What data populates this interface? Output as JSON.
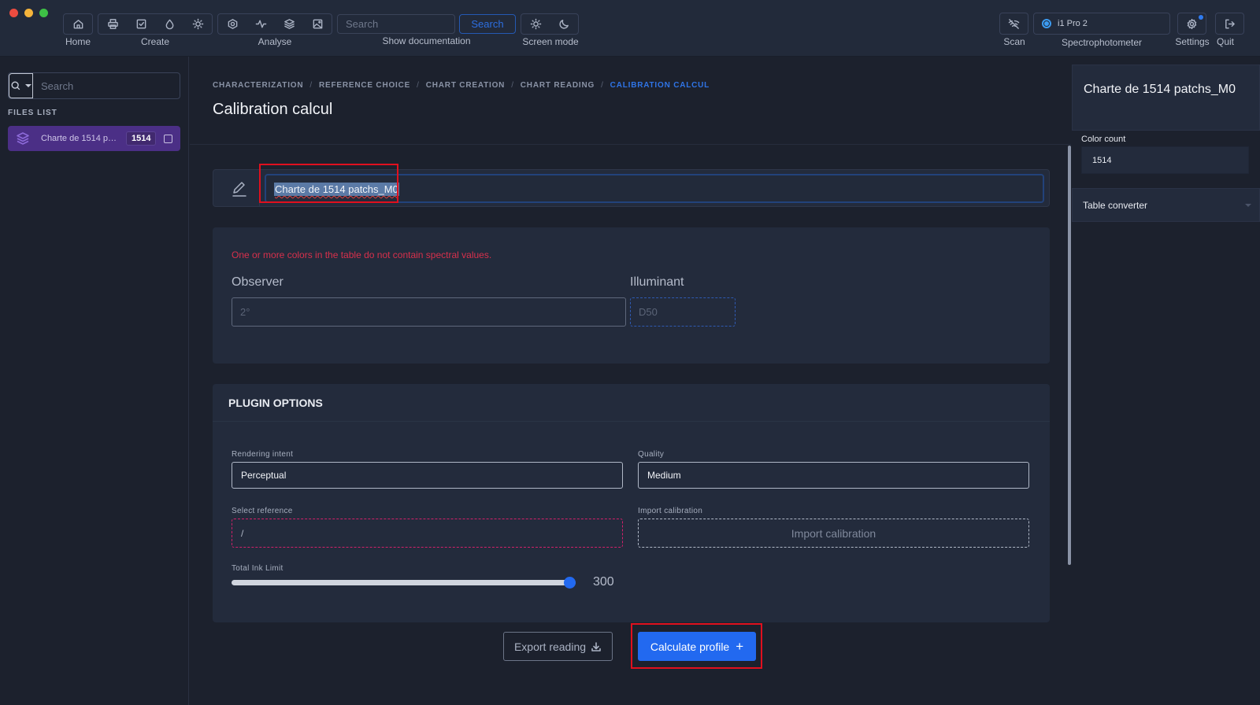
{
  "toolbar": {
    "groups": {
      "home": {
        "label": "Home"
      },
      "create": {
        "label": "Create"
      },
      "analyse": {
        "label": "Analyse"
      },
      "documentation": {
        "label": "Show documentation",
        "search_placeholder": "Search",
        "search_button": "Search"
      },
      "screen_mode": {
        "label": "Screen mode"
      }
    },
    "scan": {
      "label": "Scan"
    },
    "spectrophotometer": {
      "label": "Spectrophotometer",
      "device": "i1 Pro 2"
    },
    "settings": {
      "label": "Settings"
    },
    "quit": {
      "label": "Quit"
    }
  },
  "sidebar": {
    "search_placeholder": "Search",
    "files_list_label": "FILES LIST",
    "files": [
      {
        "name": "Charte de 1514 patchs_M0",
        "count": "1514",
        "checked": false
      }
    ]
  },
  "main": {
    "breadcrumb": [
      {
        "label": "CHARACTERIZATION",
        "active": false
      },
      {
        "label": "REFERENCE CHOICE",
        "active": false
      },
      {
        "label": "CHART CREATION",
        "active": false
      },
      {
        "label": "CHART READING",
        "active": false
      },
      {
        "label": "CALIBRATION CALCUL",
        "active": true
      }
    ],
    "breadcrumb_separator": "/",
    "title": "Calibration calcul",
    "chart_name": "Charte de 1514 patchs_M0",
    "spectral": {
      "error": "One or more colors in the table do not contain spectral values.",
      "observer_label": "Observer",
      "observer_value": "2°",
      "illuminant_label": "Illuminant",
      "illuminant_value": "D50"
    },
    "plugin_options": {
      "title": "PLUGIN OPTIONS",
      "rendering_intent_label": "Rendering intent",
      "rendering_intent_value": "Perceptual",
      "quality_label": "Quality",
      "quality_value": "Medium",
      "select_reference_label": "Select reference",
      "select_reference_value": "/",
      "import_calibration_label": "Import calibration",
      "import_calibration_button": "Import calibration",
      "total_ink_limit_label": "Total Ink Limit",
      "total_ink_limit_value": "300",
      "total_ink_limit_fraction": 1.0
    },
    "actions": {
      "export_label": "Export reading",
      "calculate_label": "Calculate profile",
      "calculate_icon": "+"
    }
  },
  "right_panel": {
    "title": "Charte de 1514 patchs_M0",
    "color_count_label": "Color count",
    "color_count_value": "1514",
    "table_converter_label": "Table converter"
  },
  "colors": {
    "accent": "#2269f0",
    "error": "#d8304c",
    "file_selected": "#4b2f86",
    "highlight": "#e0101e"
  }
}
